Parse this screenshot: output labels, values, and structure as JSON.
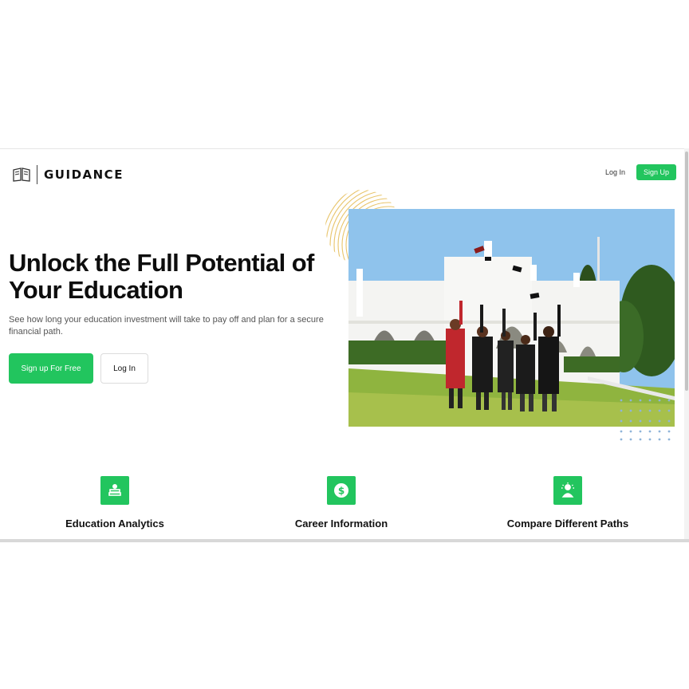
{
  "header": {
    "brand": "GUIDANCE",
    "login_label": "Log In",
    "signup_label": "Sign Up"
  },
  "hero": {
    "title": "Unlock the Full Potential of Your Education",
    "subtitle": "See how long your education investment will take to pay off and plan for a secure financial path.",
    "primary_cta": "Sign up For Free",
    "secondary_cta": "Log In"
  },
  "features": [
    {
      "title": "Education Analytics",
      "icon": "books-icon"
    },
    {
      "title": "Career Information",
      "icon": "dollar-icon"
    },
    {
      "title": "Compare Different Paths",
      "icon": "idea-person-icon"
    }
  ],
  "colors": {
    "accent": "#22c55e",
    "ring_accent": "#e8c46a",
    "dots_accent": "#8fb4d9"
  }
}
